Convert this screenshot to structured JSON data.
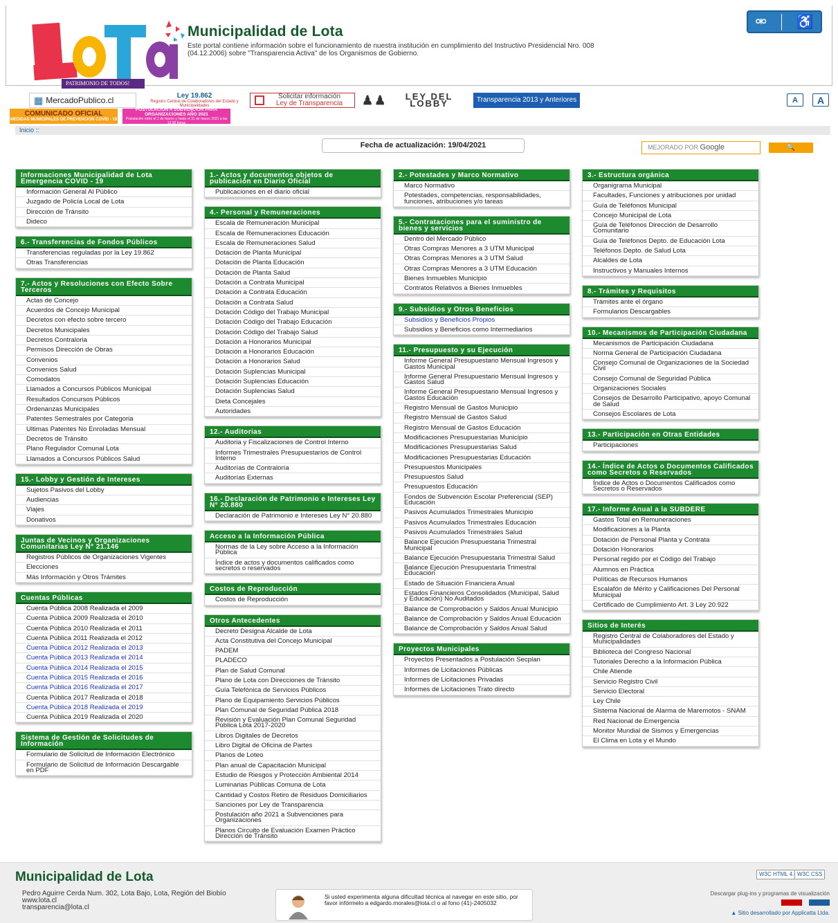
{
  "header": {
    "logo_text": "LOTA",
    "logo_tagline": "PATRIMONIO DE TODOS!",
    "title": "Municipalidad de Lota",
    "description": "Este portal contiene información sobre el funcionamiento de nuestra institución en cumplimiento del Instructivo Presidencial Nro. 008 (04.12.2006) sobre \"Transparencia Activa\" de los Organismos de Gobierno."
  },
  "banners": {
    "mercado": "MercadoPublico.cl",
    "ley_title": "Ley 19.862",
    "ley_sub": "Registro Central de Colaboradores del Estado y Municipalidades",
    "solicitar_1": "Solicitar información",
    "solicitar_2": "Ley de Transparencia",
    "lobby": "LEY DEL LOBBY",
    "transparencia": "Transparencia 2013 y Anteriores",
    "comunicado_1": "COMUNICADO OFICIAL",
    "comunicado_2": "MEDIDAS MUNICIPALES DE PREVENCION COVID - 19",
    "postulacion_1": "POSTULACIÓN A SUBVENCIÓN PARA ORGANIZACIONES AÑO 2021",
    "postulacion_2": "Postulación entre el 1 de marzo y hasta el 31 de marzo 2021 a las 13:30 horas"
  },
  "font_buttons": [
    "A",
    "A"
  ],
  "breadcrumb": "Inicio ::",
  "updated": "Fecha de actualización: 19/04/2021",
  "search": {
    "prefix": "MEJORADO POR",
    "brand": "Google",
    "button": "🔍"
  },
  "columns": [
    [
      {
        "title": "Informaciones Municipalidad de Lota Emergencia COVID - 19",
        "items": [
          "Información General Al Público",
          "Juzgado de Policía Local de Lota",
          "Dirección de Tránsito",
          "Dideco"
        ]
      },
      {
        "title": "6.- Transferencias de Fondos Públicos",
        "items": [
          "Transferencias reguladas por la Ley 19.862",
          "Otras Transferencias"
        ]
      },
      {
        "title": "7.- Actos y Resoluciones con Efecto Sobre Terceros",
        "items": [
          "Actas de Concejo",
          "Acuerdos de Concejo Municipal",
          "Decretos con efecto sobre tercero",
          "Decretos Municipales",
          "Decretos Contraloria",
          "Permisos Dirección de Obras",
          "Convenios",
          "Convenios Salud",
          "Comodatos",
          "Llamados a Concursos Públicos Municipal",
          "Resultados Concursos Públicos",
          "Ordenanzas Municipales",
          "Patentes Semestrales por Categoria",
          "Ultimas Patentes No Enroladas Mensual",
          "Decretos de Tránsito",
          "Plano Regulador Comunal Lota",
          "Llamados a Concursos Públicos Salud"
        ]
      },
      {
        "title": "15.- Lobby y Gestión de Intereses",
        "items": [
          "Sujetos Pasivos del Lobby",
          "Audiencias",
          "Viajes",
          "Donativos"
        ]
      },
      {
        "title": "Juntas de Vecinos y Organizaciones Comunitarias Ley N° 21.146",
        "items": [
          "Registros Públicos de Organizaciones Vigentes",
          "Elecciones",
          "Más Información y Otros Trámites"
        ]
      },
      {
        "title": "Cuentas Públicas",
        "items": [
          "Cuenta Pública 2008 Realizada el 2009",
          "Cuenta Pública 2009 Realizada el 2010",
          "Cuenta Pública 2010 Realizada el 2011",
          "Cuenta Pública 2011 Realizada el 2012",
          "Cuenta Pública 2012 Realizada el 2013",
          "Cuenta Pública 2013 Realizada el 2014",
          "Cuenta Pública 2014 Realizada el 2015",
          "Cuenta Pública 2015 Realizada el 2016",
          "Cuenta Pública 2016 Realizada el 2017",
          "Cuenta Pública 2017 Realizada el 2018",
          "Cuenta Pública 2018 Realizada el 2019",
          "Cuenta Pública 2019 Realizada el 2020"
        ],
        "blue": [
          4,
          5,
          6,
          7,
          8,
          10
        ]
      },
      {
        "title": "Sistema de Gestión de Solicitudes de Información",
        "items": [
          "Formulario de Solicitud de Información Electrónico",
          "Formulario de Solicitud de Información Descargable en PDF"
        ]
      }
    ],
    [
      {
        "title": "1.- Actos y documentos objetos de publicación en Diario Oficial",
        "items": [
          "Publicaciones en el diario oficial"
        ]
      },
      {
        "title": "4.- Personal y Remuneraciones",
        "items": [
          "Escala de Remuneración Municipal",
          "Escala de Remuneraciones Educación",
          "Escala de Remuneraciones Salud",
          "Dotación de Planta Municipal",
          "Dotación de Planta Educación",
          "Dotación de Planta Salud",
          "Dotación a Contrata Municipal",
          "Dotación a Contrata Educación",
          "Dotación a Contrata Salud",
          "Dotación Código del Trabajo Municipal",
          "Dotación Código del Trabajo Educación",
          "Dotación Código del Trabajo Salud",
          "Dotación a Honorarios Municipal",
          "Dotación a Honorarios Educación",
          "Dotación a Honorarios Salud",
          "Dotación Suplencias Municipal",
          "Dotación Suplencias Educación",
          "Dotación Suplencias Salud",
          "Dieta Concejales",
          "Autoridades"
        ]
      },
      {
        "title": "12.- Auditorias",
        "items": [
          "Auditoria y Fiscalizaciones de Control Interno",
          "Informes Trimestrales Presupuestarios de Control Interno",
          "Auditorías de Contraloría",
          "Auditorías Externas"
        ]
      },
      {
        "title": "16.- Declaración de Patrimonio e Intereses Ley N° 20.880",
        "items": [
          "Declaración de Patrimonio e Intereses Ley N° 20.880"
        ]
      },
      {
        "title": "Acceso a la Información Pública",
        "items": [
          "Normas de la Ley sobre Acceso a la Información Pública",
          "Índice de actos y documentos calificados como secretos o reservados"
        ]
      },
      {
        "title": "Costos de Reproducción",
        "items": [
          "Costos de Reproducción"
        ]
      },
      {
        "title": "Otros Antecedentes",
        "items": [
          "Decreto Designa Alcalde de Lota",
          "Acta Constitutiva del Concejo Municipal",
          "PADEM",
          "PLADECO",
          "Plan de Salud Comunal",
          "Plano de Lota con Direcciones de Tránsito",
          "Guía Telefónica de Servicios Públicos",
          "Plano de Equipamiento Servicios Públicos",
          "Plan Comunal de Seguridad Pública 2018",
          "Revisión y Evaluación Plan Comunal Seguridad Pública Lota 2017-2020",
          "Libros Digitales de Decretos",
          "Libro Digital de Oficina de Partes",
          "Planos de Loteo",
          "Plan anual de Capacitación Municipal",
          "Estudio de Riesgos y Protección Ambiental 2014",
          "Luminarias Públicas Comuna de Lota",
          "Cantidad y Costos Retiro de Residuos Domiciliarios",
          "Sanciones por Ley de Transparencia",
          "Postulación año 2021 a Subvenciones para Organizaciones",
          "Planos Circuito de Evaluación Examen Práctico Dirección de Tránsito"
        ]
      }
    ],
    [
      {
        "title": "2.- Potestades y Marco Normativo",
        "items": [
          "Marco Normativo",
          "Potestades, competencias, responsabilidades, funciones, atribuciones y/o tareas"
        ]
      },
      {
        "title": "5.- Contrataciones para el suministro de bienes y servicios",
        "items": [
          "Dentro del Mercado Público",
          "Otras Compras Menores a 3 UTM Municipal",
          "Otras Compras Menores a 3 UTM Salud",
          "Otras Compras Menores a 3 UTM Educación",
          "Bienes Inmuebles Municipio",
          "Contratos Relativos a Bienes Inmuebles"
        ]
      },
      {
        "title": "9.- Subsidios y Otros Beneficios",
        "items": [
          "Subsidios y Beneficios Propios",
          "Subsidios y Beneficios como Intermediarios"
        ],
        "blue": [
          0
        ]
      },
      {
        "title": "11.- Presupuesto y su Ejecución",
        "items": [
          "Informe General Presupuestario Mensual Ingresos y Gastos Municipal",
          "Informe General Presupuestario Mensual Ingresos y Gastos Salud",
          "Informe General Presupuestario Mensual Ingresos y Gastos Educación",
          "Registro Mensual de Gastos Municipio",
          "Registro Mensual de Gastos Salud",
          "Registro Mensual de Gastos Educación",
          "Modificaciones Presupuestarias Municipio",
          "Modificaciones Presupuestarias Salud",
          "Modificaciones Presupuestarias Educación",
          "Presupuestos Municipales",
          "Presupuestos Salud",
          "Presupuestos Educación",
          "Fondos de Subvención Escolar Preferencial (SEP) Educación",
          "Pasivos Acumulados Trimestrales Municipio",
          "Pasivos Acumulados Trimestrales Educación",
          "Pasivos Acumulados Trimestrales Salud",
          "Balance Ejecución Presupuestaria Trimestral Municipal",
          "Balance Ejecución Presupuestaria Trimestral Salud",
          "Balance Ejecución Presupuestaria Trimestral Educación",
          "Estado de Situación Financiera Anual",
          "Estados Financieros Consolidados (Municipal, Salud y Educación) No Auditados",
          "Balance de Comprobación y Saldos Anual Municipio",
          "Balance de Comprobación y Saldos Anual Educación",
          "Balance de Comprobación y Saldos Anual Salud"
        ]
      },
      {
        "title": "Proyectos Municipales",
        "items": [
          "Proyectos Presentados a Postulación Secplan",
          "Informes de Licitaciones Públicas",
          "Informes de Licitaciones Privadas",
          "Informes de Licitaciones Trato directo"
        ]
      }
    ],
    [
      {
        "title": "3.- Estructura orgánica",
        "items": [
          "Organigrama Municipal",
          "Facultades, Funciones y atribuciones por unidad",
          "Guía de Teléfonos Municipal",
          "Concejo Municipal de Lota",
          "Guía de Teléfonos Dirección de Desarrollo Comunitario",
          "Guía de Teléfonos Depto. de Educación Lota",
          "Teléfonos Depto. de Salud Lota",
          "Alcaldes de Lota",
          "Instructivos y Manuales Internos"
        ]
      },
      {
        "title": "8.- Trámites y Requisitos",
        "items": [
          "Trámites ante el órgano",
          "Formularios Descargables"
        ]
      },
      {
        "title": "10.- Mecanismos de Participación Ciudadana",
        "items": [
          "Mecanismos de Participación Ciudadana",
          "Norma General de Participación Ciudadana",
          "Consejo Comunal de Organizaciones de la Sociedad Civil",
          "Consejo Comunal de Seguridad Pública",
          "Organizaciones Sociales",
          "Consejos de Desarrollo Participativo, apoyo Comunal de Salud",
          "Consejos Escolares de Lota"
        ]
      },
      {
        "title": "13.- Participación en Otras Entidades",
        "items": [
          "Participaciones"
        ]
      },
      {
        "title": "14.- Índice de Actos o Documentos Calificados como Secretos o Reservados",
        "items": [
          "Índice de Actos o Documentos Calificados como Secretos o Reservados"
        ]
      },
      {
        "title": "17.- Informe Anual a la SUBDERE",
        "items": [
          "Gastos Total en Remuneraciones",
          "Modificaciones a la Planta",
          "Dotación de Personal Planta y Contrata",
          "Dotación Honorarios",
          "Personal regido por el Código del Trabajo",
          "Alumnos en Práctica",
          "Políticas de Recursos Humanos",
          "Escalafón de Mérito y Calificaciones Del Personal Municipal",
          "Certificado de Cumplimiento Art. 3 Ley 20.922"
        ]
      },
      {
        "title": "Sitios de Interés",
        "items": [
          "Registro Central de Colaboradores del Estado y Municipalidades",
          "Biblioteca del Congreso Nacional",
          "Tutoriales Derecho a la Información Pública",
          "Chile Atiende",
          "Servicio Registro Civil",
          "Servicio Electoral",
          "Ley Chile",
          "Sistema Nacional de Alarma de Maremotos - SNAM",
          "Red Nacional de Emergencia",
          "Monitor Mundial de Sismos y Emergencias",
          "El Clima en Lota y el Mundo"
        ]
      }
    ]
  ],
  "footer": {
    "title": "Municipalidad de Lota",
    "address": "Pedro Aguirre Cerda Num. 302, Lota Bajo, Lota, Región del Biobío",
    "web": "www.lota.cl",
    "email": "transparencia@lota.cl",
    "help": "Si usted experimenta alguna dificultad técnica al navegar en este sitio, por favor infórmelo a edgardo.morales@lota.cl o al fono (41)-2405032",
    "plugins": "Descargar plug-ins y programas de visualización",
    "developer": "Sitio desarrollado por Applicatta Ltda.",
    "w3c_html": "W3C HTML 4.01",
    "w3c_css": "W3C CSS"
  }
}
